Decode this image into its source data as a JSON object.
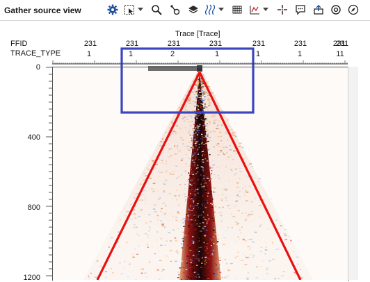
{
  "window": {
    "title": "Gather source view"
  },
  "toolbar": {
    "icons": [
      "gear-icon",
      "select-region-icon",
      "zoom-icon",
      "pick-icon",
      "layers-icon",
      "wiggle-icon",
      "header-table-icon",
      "chart-icon",
      "crosshair-icon",
      "comment-icon",
      "export-icon",
      "settings-icon",
      "compass-icon"
    ]
  },
  "header": {
    "axis_title": "Trace [Trace]",
    "rows": [
      {
        "label": "FFID",
        "values": [
          "231",
          "231",
          "231",
          "231",
          "231",
          "231",
          "231",
          "231"
        ]
      },
      {
        "label": "TRACE_TYPE",
        "values": [
          "1",
          "1",
          "2",
          "1",
          "1",
          "1",
          "11"
        ]
      }
    ]
  },
  "y_axis": {
    "ticks": [
      "0",
      "400",
      "800",
      "1200"
    ]
  },
  "colors": {
    "accent": "#3b45c0",
    "overlay": "#e81010",
    "scale_bar": "#6e6e6e"
  }
}
